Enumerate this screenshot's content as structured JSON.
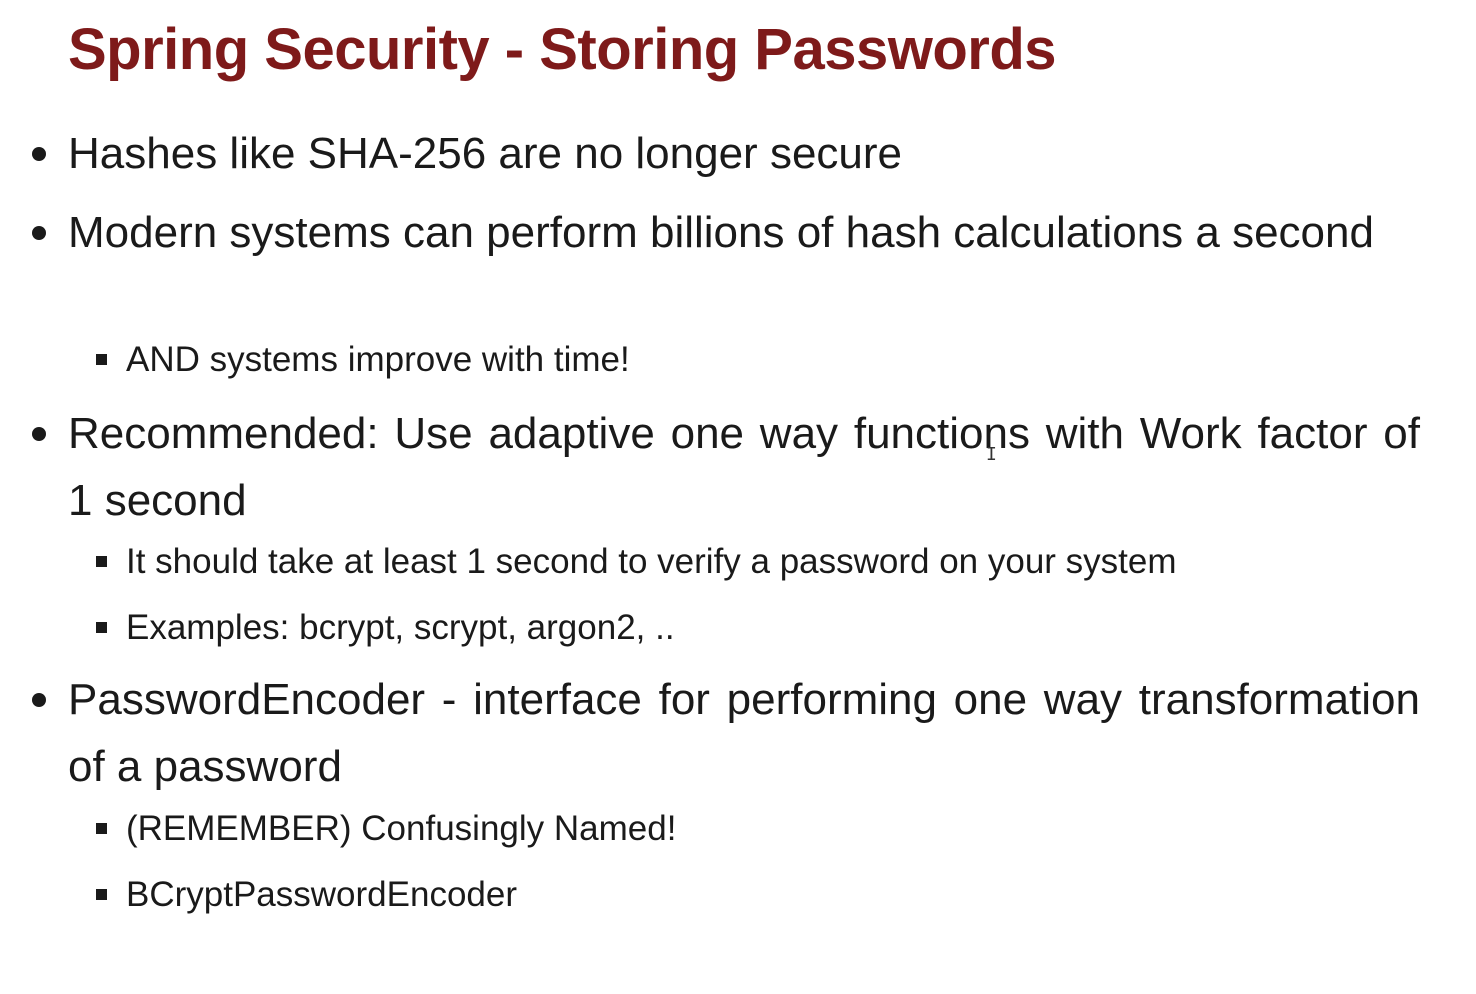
{
  "slide": {
    "title": "Spring Security - Storing Passwords",
    "bullets": [
      {
        "text": "Hashes like SHA-256 are no longer secure",
        "subbullets": []
      },
      {
        "text": "Modern systems can perform billions of hash calculations a second",
        "subbullets": [
          "AND systems improve with time!"
        ]
      },
      {
        "text": "Recommended: Use adaptive one way functions with Work factor of 1 second",
        "subbullets": [
          "It should take at least 1 second to verify a password on your system",
          "Examples: bcrypt, scrypt, argon2, .."
        ]
      },
      {
        "text": "PasswordEncoder - interface for performing one way transformation of a password",
        "subbullets": [
          "(REMEMBER) Confusingly Named!",
          "BCryptPasswordEncoder"
        ]
      }
    ]
  },
  "colors": {
    "title": "#7e1a1a",
    "body_text": "#1a1a1a",
    "background": "#ffffff"
  },
  "cursor": {
    "icon": "text-cursor-icon",
    "glyph": "I"
  }
}
